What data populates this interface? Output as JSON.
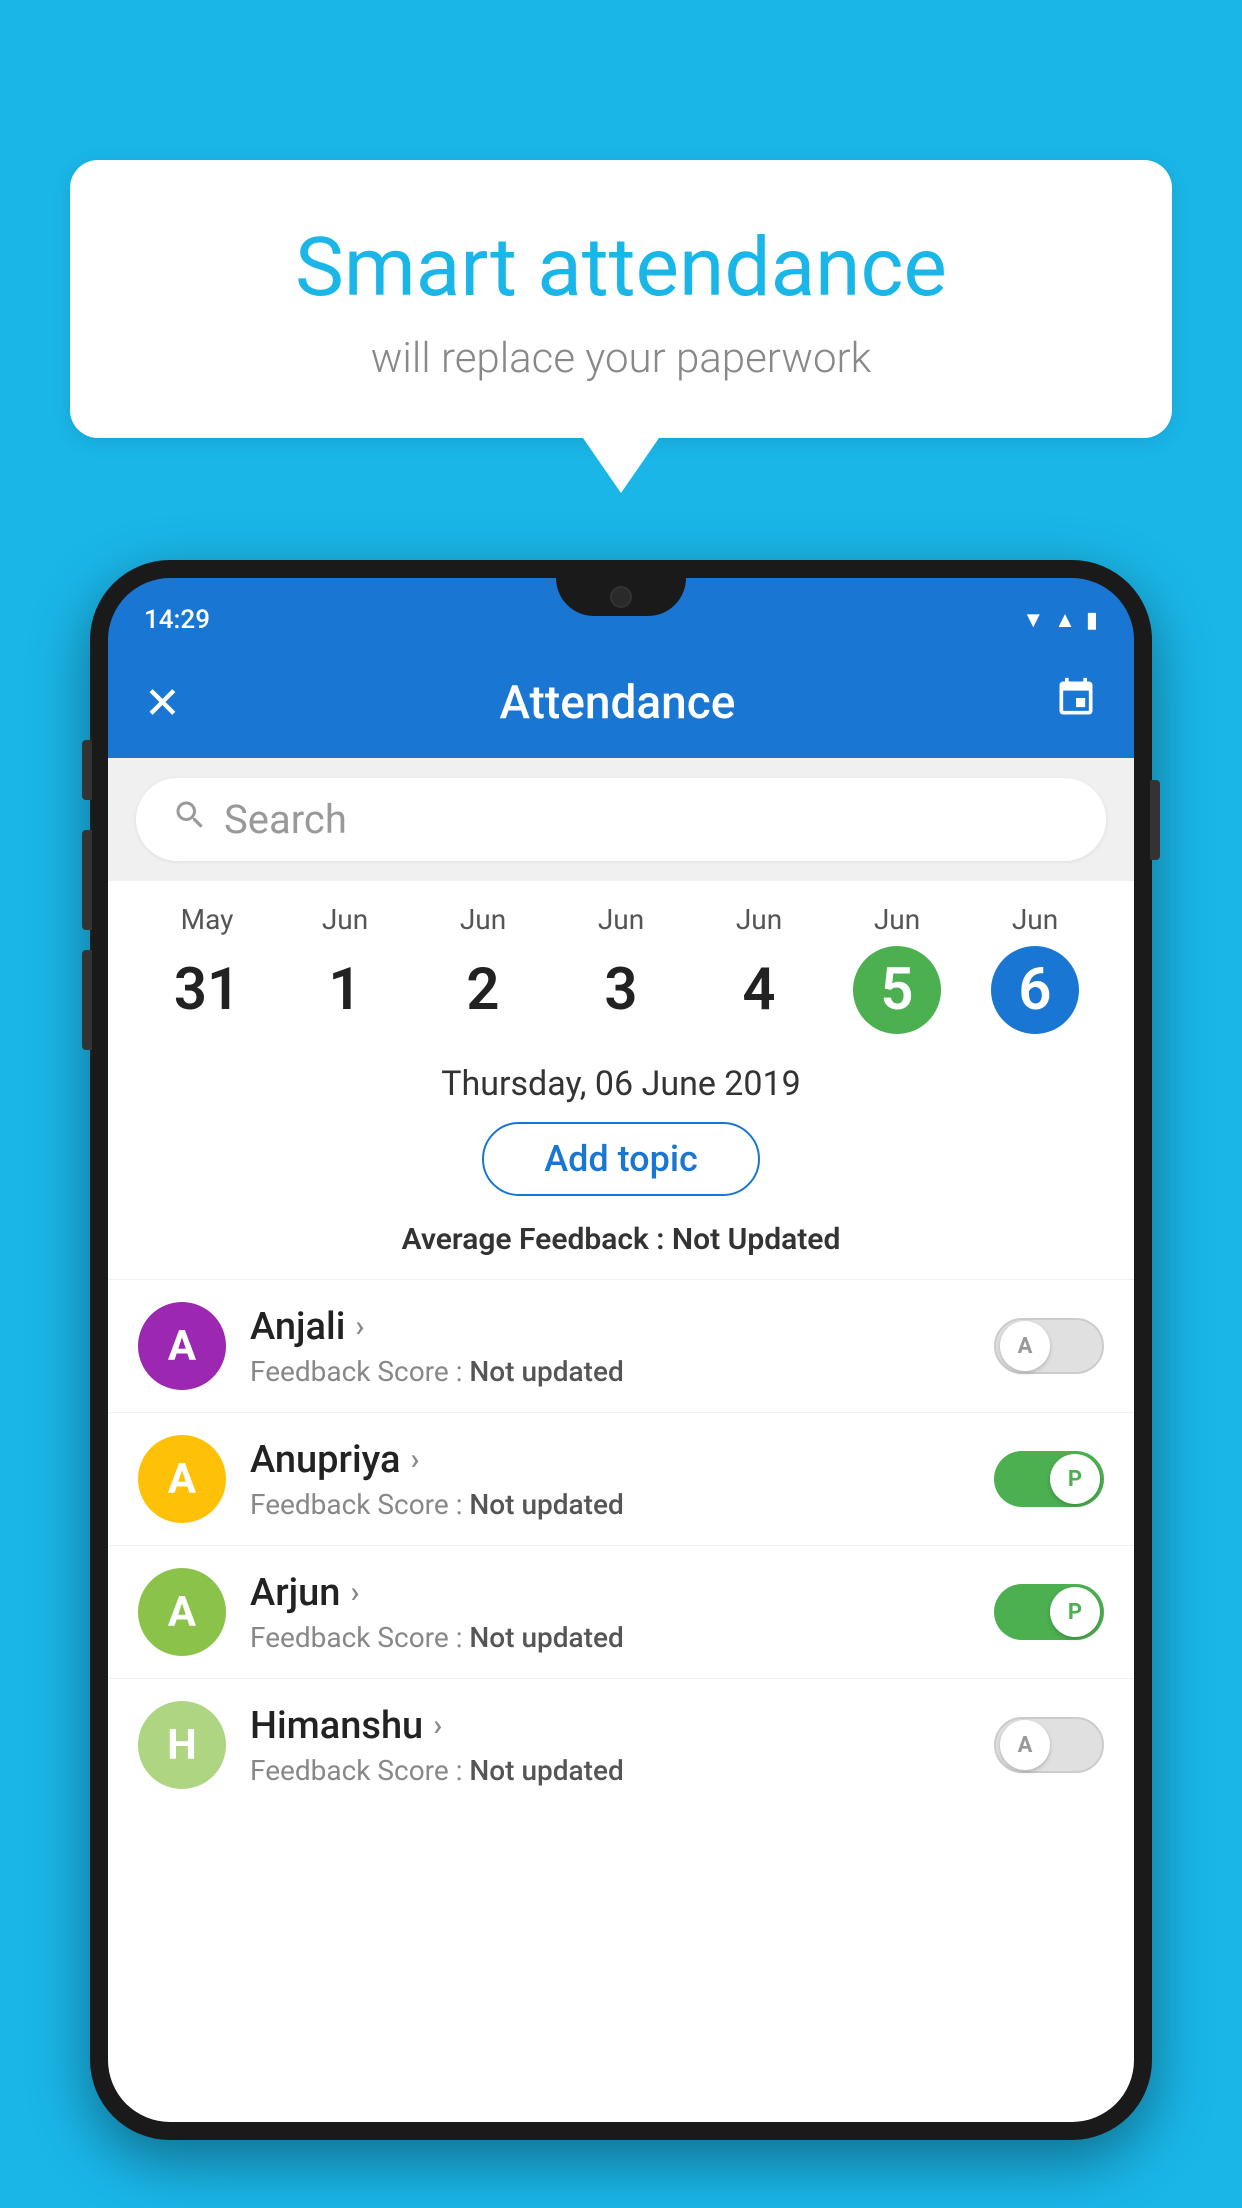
{
  "background_color": "#1ab6e8",
  "speech_bubble": {
    "title": "Smart attendance",
    "subtitle": "will replace your paperwork"
  },
  "phone": {
    "status_bar": {
      "time": "14:29",
      "icons": [
        "wifi",
        "signal",
        "battery"
      ]
    },
    "app_bar": {
      "title": "Attendance",
      "close_icon": "✕",
      "calendar_icon": "📅"
    },
    "search": {
      "placeholder": "Search"
    },
    "calendar": {
      "days": [
        {
          "month": "May",
          "date": "31",
          "selected": false
        },
        {
          "month": "Jun",
          "date": "1",
          "selected": false
        },
        {
          "month": "Jun",
          "date": "2",
          "selected": false
        },
        {
          "month": "Jun",
          "date": "3",
          "selected": false
        },
        {
          "month": "Jun",
          "date": "4",
          "selected": false
        },
        {
          "month": "Jun",
          "date": "5",
          "selected": "green"
        },
        {
          "month": "Jun",
          "date": "6",
          "selected": "blue"
        }
      ]
    },
    "selected_date": "Thursday, 06 June 2019",
    "add_topic_label": "Add topic",
    "avg_feedback_label": "Average Feedback :",
    "avg_feedback_value": "Not Updated",
    "students": [
      {
        "name": "Anjali",
        "avatar_letter": "A",
        "avatar_color": "#9c27b0",
        "feedback_label": "Feedback Score :",
        "feedback_value": "Not updated",
        "toggle": "off",
        "toggle_letter": "A"
      },
      {
        "name": "Anupriya",
        "avatar_letter": "A",
        "avatar_color": "#ffc107",
        "feedback_label": "Feedback Score :",
        "feedback_value": "Not updated",
        "toggle": "on",
        "toggle_letter": "P"
      },
      {
        "name": "Arjun",
        "avatar_letter": "A",
        "avatar_color": "#8bc34a",
        "feedback_label": "Feedback Score :",
        "feedback_value": "Not updated",
        "toggle": "on",
        "toggle_letter": "P"
      },
      {
        "name": "Himanshu",
        "avatar_letter": "H",
        "avatar_color": "#aed581",
        "feedback_label": "Feedback Score :",
        "feedback_value": "Not updated",
        "toggle": "off",
        "toggle_letter": "A"
      }
    ]
  }
}
